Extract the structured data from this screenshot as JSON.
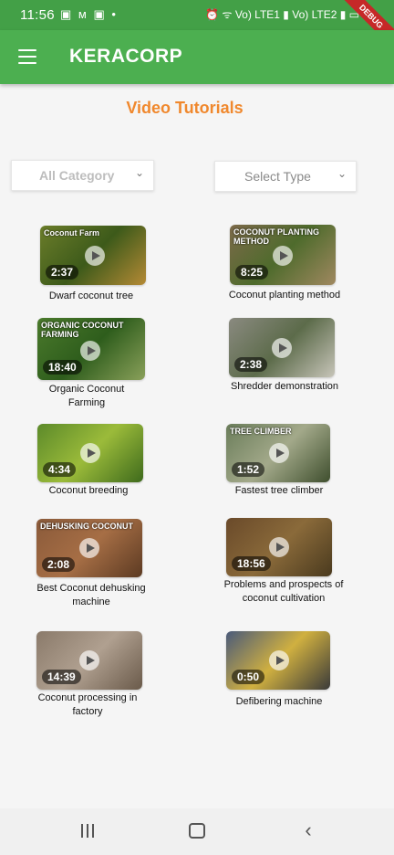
{
  "status_bar": {
    "time": "11:56",
    "left_icons": "▣ ᴍ ▣ •",
    "right_icons": "⏰ ᯤ Vo) LTE1 ▮ Vo) LTE2 ▮ ▭",
    "debug_label": "DEBUG"
  },
  "app_bar": {
    "title": "KERACORP",
    "menu_icon": "hamburger-icon"
  },
  "page": {
    "heading": "Video Tutorials"
  },
  "filters": {
    "category": {
      "value": "All Category",
      "icon": "chevron-down-icon"
    },
    "type": {
      "value": "Select Type",
      "icon": "chevron-down-icon"
    }
  },
  "videos": [
    {
      "title": "Dwarf coconut tree",
      "duration": "2:37",
      "overlay": "Coconut Farm",
      "colors": [
        "#6b7d2a",
        "#3d5a1a",
        "#b58a35"
      ]
    },
    {
      "title": "Coconut planting method",
      "duration": "8:25",
      "overlay": "COCONUT PLANTING METHOD",
      "colors": [
        "#7d6a4a",
        "#4e6b2c",
        "#a08860"
      ]
    },
    {
      "title": "Organic Coconut Farming",
      "duration": "18:40",
      "overlay": "ORGANIC COCONUT FARMING",
      "colors": [
        "#4b7a2c",
        "#2e5d1c",
        "#8aa05a"
      ]
    },
    {
      "title": "Shredder demonstration",
      "duration": "2:38",
      "overlay": "",
      "colors": [
        "#8a8a80",
        "#5c6b4a",
        "#c7c5b9"
      ]
    },
    {
      "title": "Coconut breeding",
      "duration": "4:34",
      "overlay": "",
      "colors": [
        "#5c8a2a",
        "#9bbb3a",
        "#3e6a1c"
      ]
    },
    {
      "title": "Fastest tree climber",
      "duration": "1:52",
      "overlay": "TREE CLIMBER",
      "colors": [
        "#6a7d5a",
        "#a3a98a",
        "#3f4f2e"
      ]
    },
    {
      "title": "Best Coconut dehusking machine",
      "duration": "2:08",
      "overlay": "DEHUSKING COCONUT",
      "colors": [
        "#8a5a3a",
        "#a66e45",
        "#5c3a22"
      ]
    },
    {
      "title": "Problems and prospects of coconut cultivation",
      "duration": "18:56",
      "overlay": "",
      "colors": [
        "#6a4a2a",
        "#8a6a3a",
        "#4a3a1e"
      ]
    },
    {
      "title": "Coconut processing in factory",
      "duration": "14:39",
      "overlay": "",
      "colors": [
        "#8a7a6a",
        "#b0a090",
        "#6a5a4a"
      ]
    },
    {
      "title": "Defibering machine",
      "duration": "0:50",
      "overlay": "",
      "colors": [
        "#4a5a7a",
        "#d0b040",
        "#3a3a3a"
      ]
    }
  ],
  "nav_bar": {
    "recent": "recent-apps-icon",
    "home": "home-icon",
    "back": "back-icon"
  }
}
